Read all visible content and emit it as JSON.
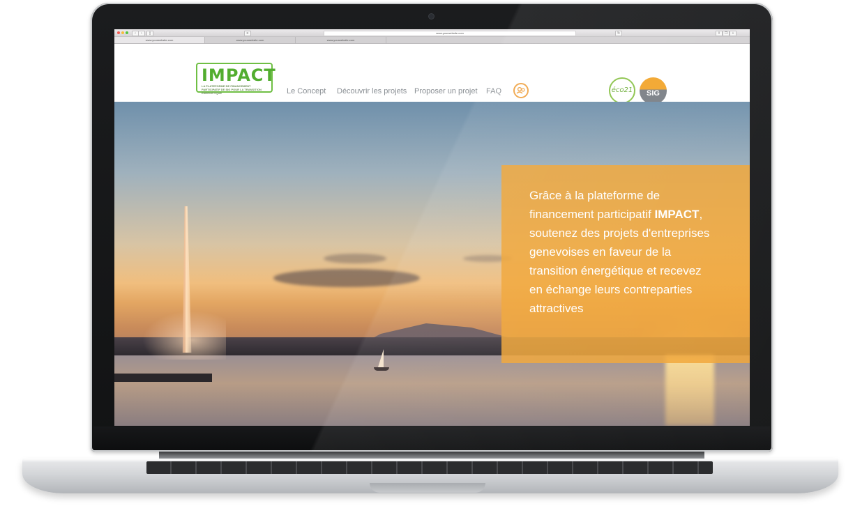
{
  "browser": {
    "url": "www.yourwebsite.com",
    "tabs": [
      "www.yourwebsite.com",
      "www.yourwebsite.com",
      "www.yourwebsite.com"
    ]
  },
  "site": {
    "logo": {
      "title": "IMPACT",
      "subtitle": "LA PLATEFORME DE FINANCEMENT PARTICIPATIF DE SIG POUR LA TRANSITION ÉNERGÉTIQUE"
    },
    "nav": {
      "concept": "Le Concept",
      "discover": "Découvrir les projets",
      "propose": "Proposer un projet",
      "faq": "FAQ"
    },
    "partners": {
      "eco": "éco21",
      "sig": "SIG"
    }
  },
  "hero": {
    "text_before": "Grâce à la plateforme de financement participatif ",
    "text_bold": "IMPACT",
    "text_after": ", soutenez des projets d'entreprises genevoises en faveur de la transition énergétique et recevez en échange leurs contreparties attractives"
  },
  "colors": {
    "brand_green": "#52ad2f",
    "accent_orange": "#f0a434",
    "nav_gray": "#8a8f94"
  },
  "icons": [
    "user-account-icon",
    "camera-icon"
  ]
}
